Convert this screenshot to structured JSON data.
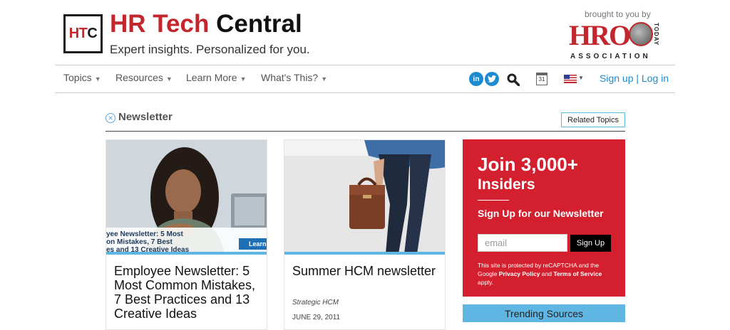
{
  "brand": {
    "logo_part1": "HT",
    "logo_part2": "C",
    "title_red": "HR Tech",
    "title_dark": "Central",
    "tagline": "Expert insights. Personalized for you."
  },
  "sponsor": {
    "brought_by": "brought to you by",
    "name": "HRO",
    "today": "TODAY",
    "association": "ASSOCIATION"
  },
  "nav": {
    "items": [
      {
        "label": "Topics"
      },
      {
        "label": "Resources"
      },
      {
        "label": "Learn More"
      },
      {
        "label": "What's This?"
      }
    ],
    "linkedin": "in",
    "calendar_day": "31",
    "auth": "Sign up | Log in"
  },
  "section": {
    "title": "Newsletter",
    "related_button": "Related Topics"
  },
  "cards": [
    {
      "title": "Employee Newsletter: 5 Most Common Mistakes, 7 Best Practices and 13 Creative Ideas",
      "image_overlay": "yee Newsletter: 5 Most\non Mistakes, 7 Best\nes and 13 Creative Ideas",
      "image_button": "Learn"
    },
    {
      "title": "Summer HCM newsletter",
      "source": "Strategic HCM",
      "date": "JUNE 29, 2011"
    }
  ],
  "join": {
    "heading_prefix": "Join",
    "heading_number": "3,000+",
    "heading_line2": "Insiders",
    "subheading": "Sign Up for our Newsletter",
    "email_placeholder": "email",
    "submit_label": "Sign Up",
    "note_1": "This site is protected by reCAPTCHA and the Google ",
    "note_privacy": "Privacy Policy",
    "note_and": " and ",
    "note_terms": "Terms of Service",
    "note_2": " apply."
  },
  "trending": {
    "title": "Trending Sources"
  },
  "colors": {
    "brand_red": "#c1272d",
    "join_red": "#d4202e",
    "accent_blue": "#5fb6e2",
    "link_blue": "#1d8bd0"
  }
}
